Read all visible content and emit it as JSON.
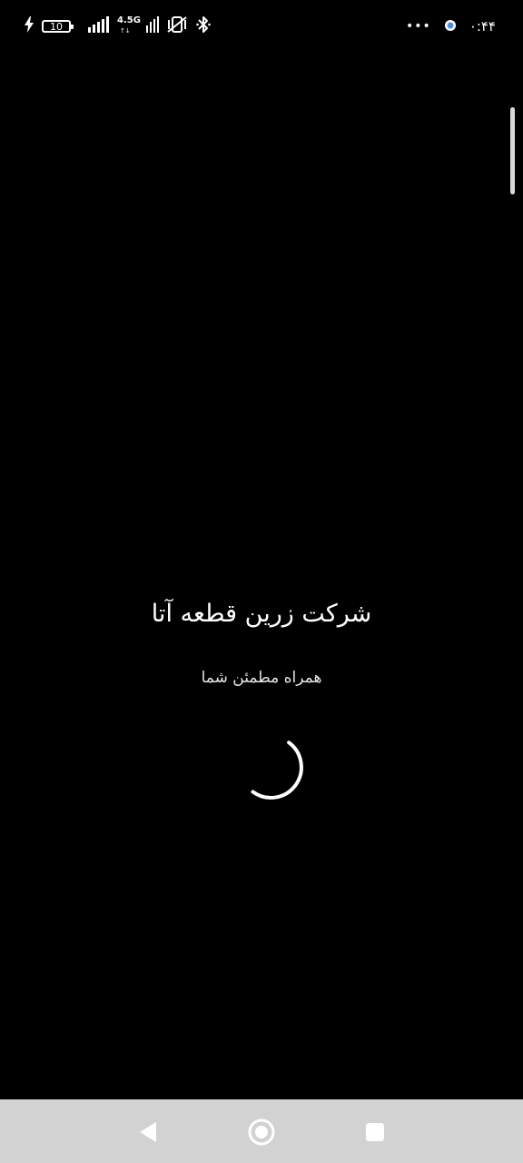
{
  "status_bar": {
    "battery_level": "10",
    "network_type": "4.5G",
    "network_activity": "↑↓",
    "more_dots": "•••",
    "clock": "۰:۴۴"
  },
  "splash": {
    "company_name": "شرکت زرین قطعه آتا",
    "slogan": "همراه مطمئن شما"
  },
  "icons": {
    "charging": "charging-icon",
    "battery": "battery-icon",
    "signal": "signal-icon",
    "mute": "vibrate-mute-icon",
    "bluetooth": "bluetooth-icon",
    "notification": "notification-dot-icon",
    "spinner": "loading-spinner-icon",
    "back": "back-icon",
    "home": "home-icon",
    "recents": "recents-icon"
  },
  "colors": {
    "background": "#000000",
    "text": "#ffffff",
    "nav_bar": "#d2d2d2",
    "nav_icons": "#ffffff",
    "notification_dot": "#4a90e2"
  }
}
